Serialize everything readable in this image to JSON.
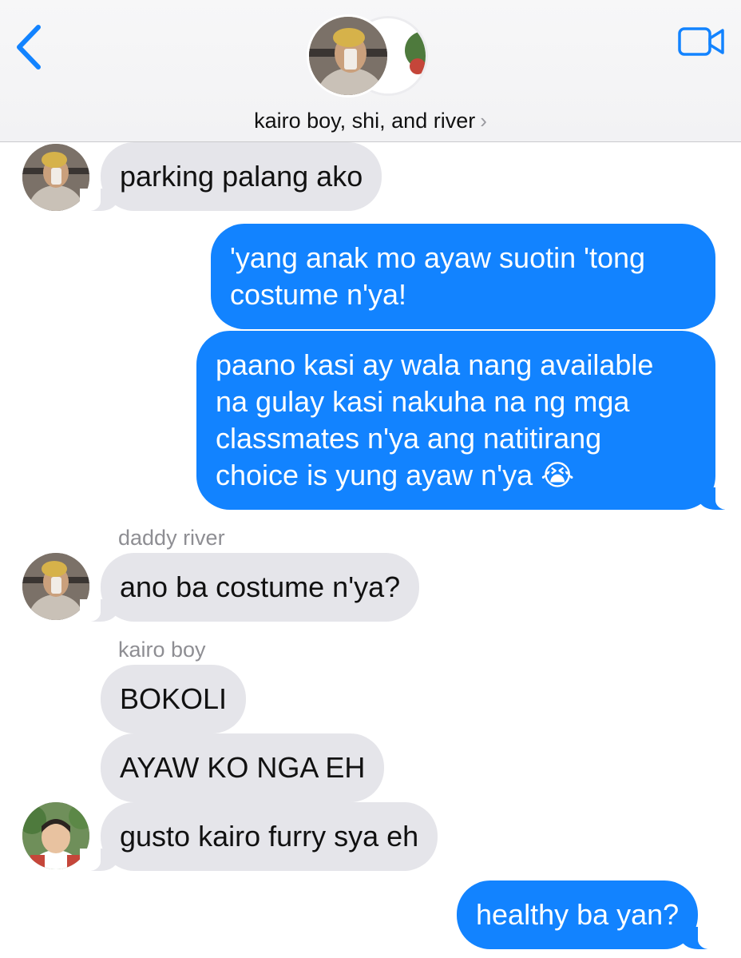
{
  "header": {
    "back_icon": "chevron-left-icon",
    "video_icon": "video-camera-icon",
    "title": "kairo boy, shi, and river",
    "title_chevron": "›",
    "accent_color": "#1283ff"
  },
  "messages": [
    {
      "direction": "incoming",
      "sender": "",
      "text": "parking palang ako"
    },
    {
      "direction": "outgoing",
      "text": "'yang anak mo ayaw suotin 'tong\ncostume n'ya!"
    },
    {
      "direction": "outgoing",
      "text": "paano kasi ay wala nang available\nna gulay kasi nakuha na ng mga\nclassmates n'ya ang natitirang\nchoice is yung ayaw n'ya 😭"
    },
    {
      "direction": "incoming",
      "sender": "daddy river",
      "text": "ano ba costume n'ya?"
    },
    {
      "direction": "incoming",
      "sender": "kairo boy",
      "text": "BOKOLI"
    },
    {
      "direction": "incoming",
      "sender": "",
      "text": "AYAW KO NGA EH"
    },
    {
      "direction": "incoming",
      "sender": "",
      "text": "gusto kairo furry sya eh"
    },
    {
      "direction": "outgoing",
      "text": "healthy ba yan?"
    }
  ],
  "colors": {
    "incoming_bubble": "#e5e5ea",
    "outgoing_bubble": "#1283ff",
    "sender_label": "#8e8e93"
  }
}
